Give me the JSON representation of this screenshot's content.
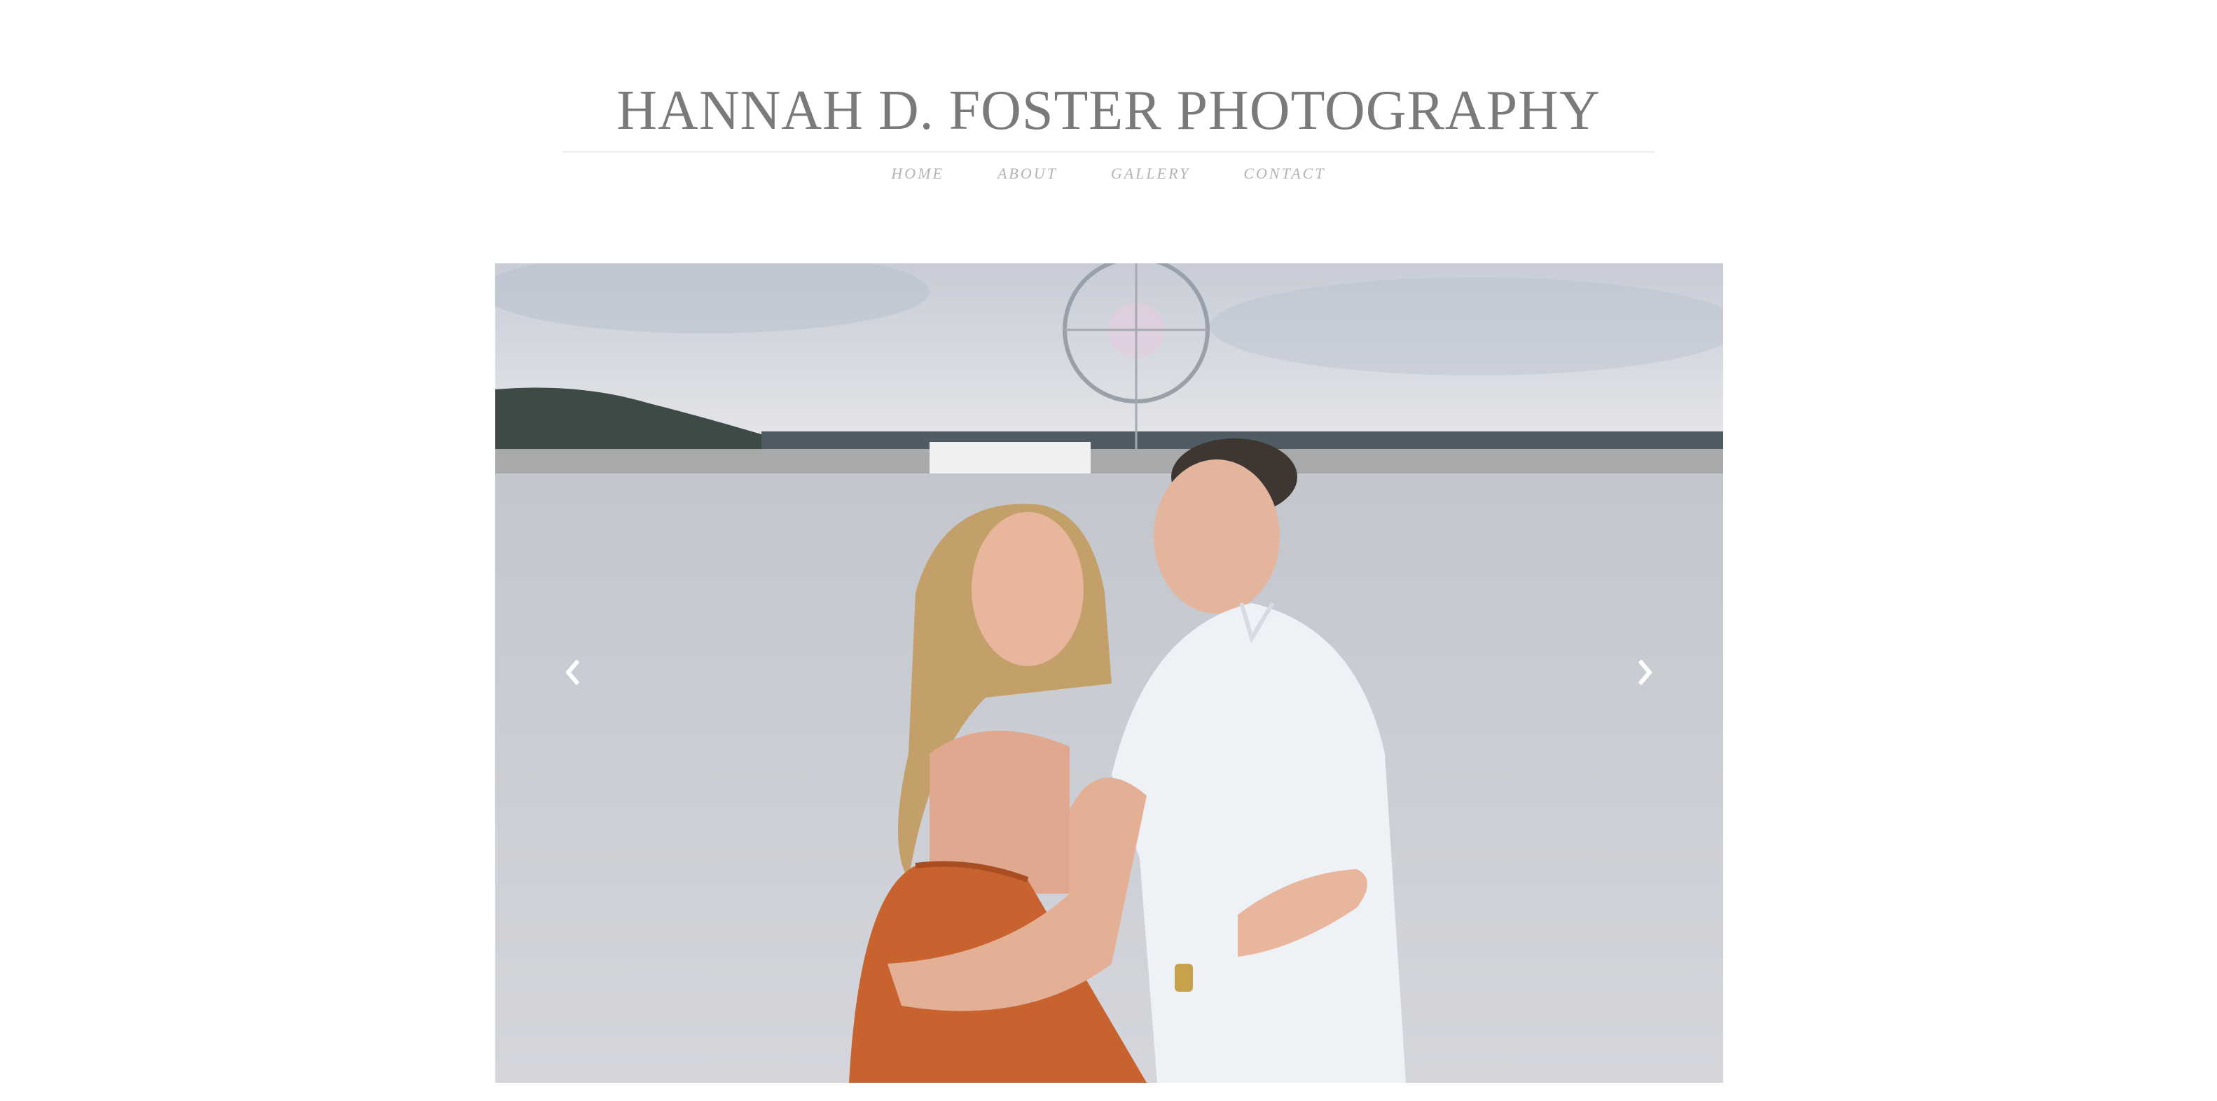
{
  "header": {
    "site_title": "HANNAH D. FOSTER PHOTOGRAPHY"
  },
  "nav": {
    "items": [
      {
        "label": "HOME"
      },
      {
        "label": "ABOUT"
      },
      {
        "label": "GALLERY"
      },
      {
        "label": "CONTACT"
      }
    ]
  },
  "slider": {
    "prev_icon": "chevron-left-icon",
    "next_icon": "chevron-right-icon"
  },
  "colors": {
    "title": "#7a7a7a",
    "nav": "#b3b3b3",
    "water": "#c9ccd3",
    "sky": "#dfe1e6",
    "dress": "#c8622e",
    "shirt": "#eef1f6"
  }
}
